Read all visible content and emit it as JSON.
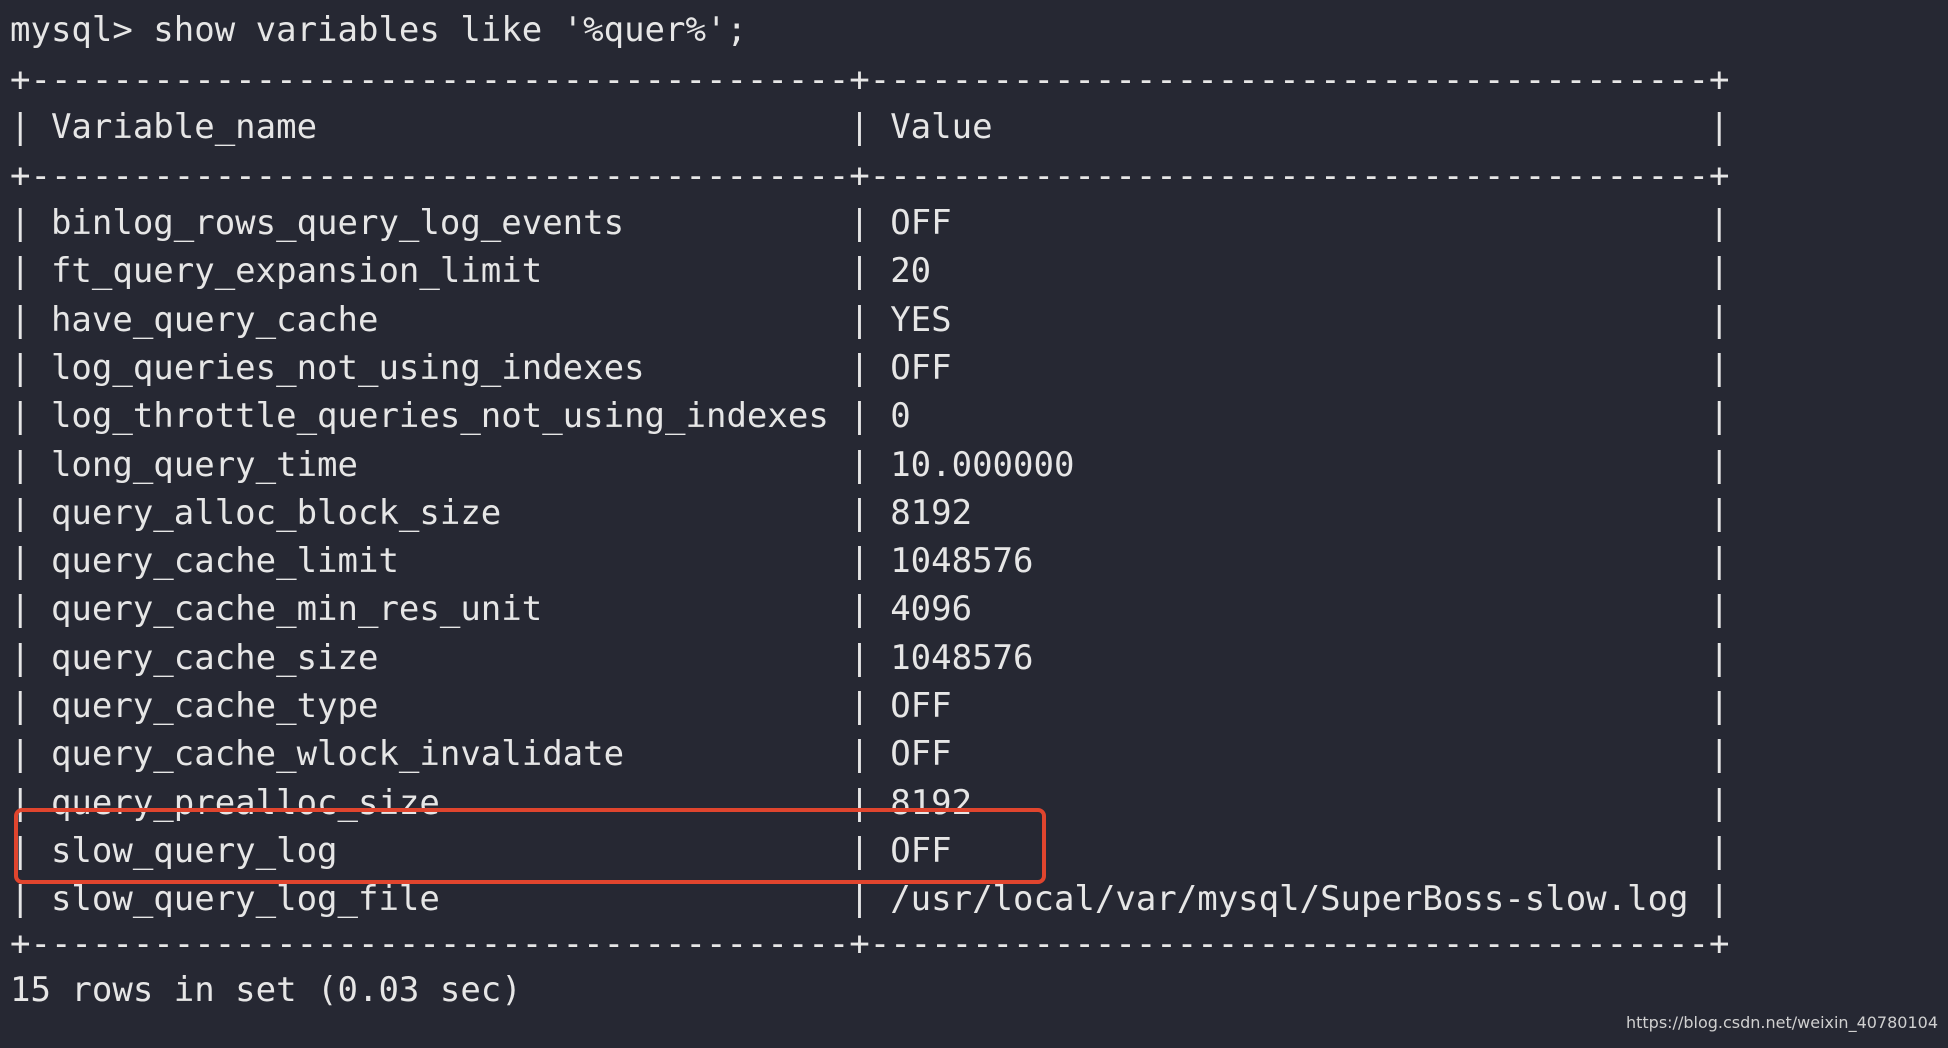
{
  "prompt": "mysql> show variables like '%quer%';",
  "table": {
    "headers": [
      "Variable_name",
      "Value"
    ],
    "rows": [
      [
        "binlog_rows_query_log_events",
        "OFF"
      ],
      [
        "ft_query_expansion_limit",
        "20"
      ],
      [
        "have_query_cache",
        "YES"
      ],
      [
        "log_queries_not_using_indexes",
        "OFF"
      ],
      [
        "log_throttle_queries_not_using_indexes",
        "0"
      ],
      [
        "long_query_time",
        "10.000000"
      ],
      [
        "query_alloc_block_size",
        "8192"
      ],
      [
        "query_cache_limit",
        "1048576"
      ],
      [
        "query_cache_min_res_unit",
        "4096"
      ],
      [
        "query_cache_size",
        "1048576"
      ],
      [
        "query_cache_type",
        "OFF"
      ],
      [
        "query_cache_wlock_invalidate",
        "OFF"
      ],
      [
        "query_prealloc_size",
        "8192"
      ],
      [
        "slow_query_log",
        "OFF"
      ],
      [
        "slow_query_log_file",
        "/usr/local/var/mysql/SuperBoss-slow.log"
      ]
    ],
    "highlighted_row": "slow_query_log"
  },
  "result_summary": "15 rows in set (0.03 sec)",
  "watermark": "https://blog.csdn.net/weixin_40780104",
  "colors": {
    "background": "#262833",
    "text": "#e6e6e6",
    "highlight": "#e0452e"
  }
}
